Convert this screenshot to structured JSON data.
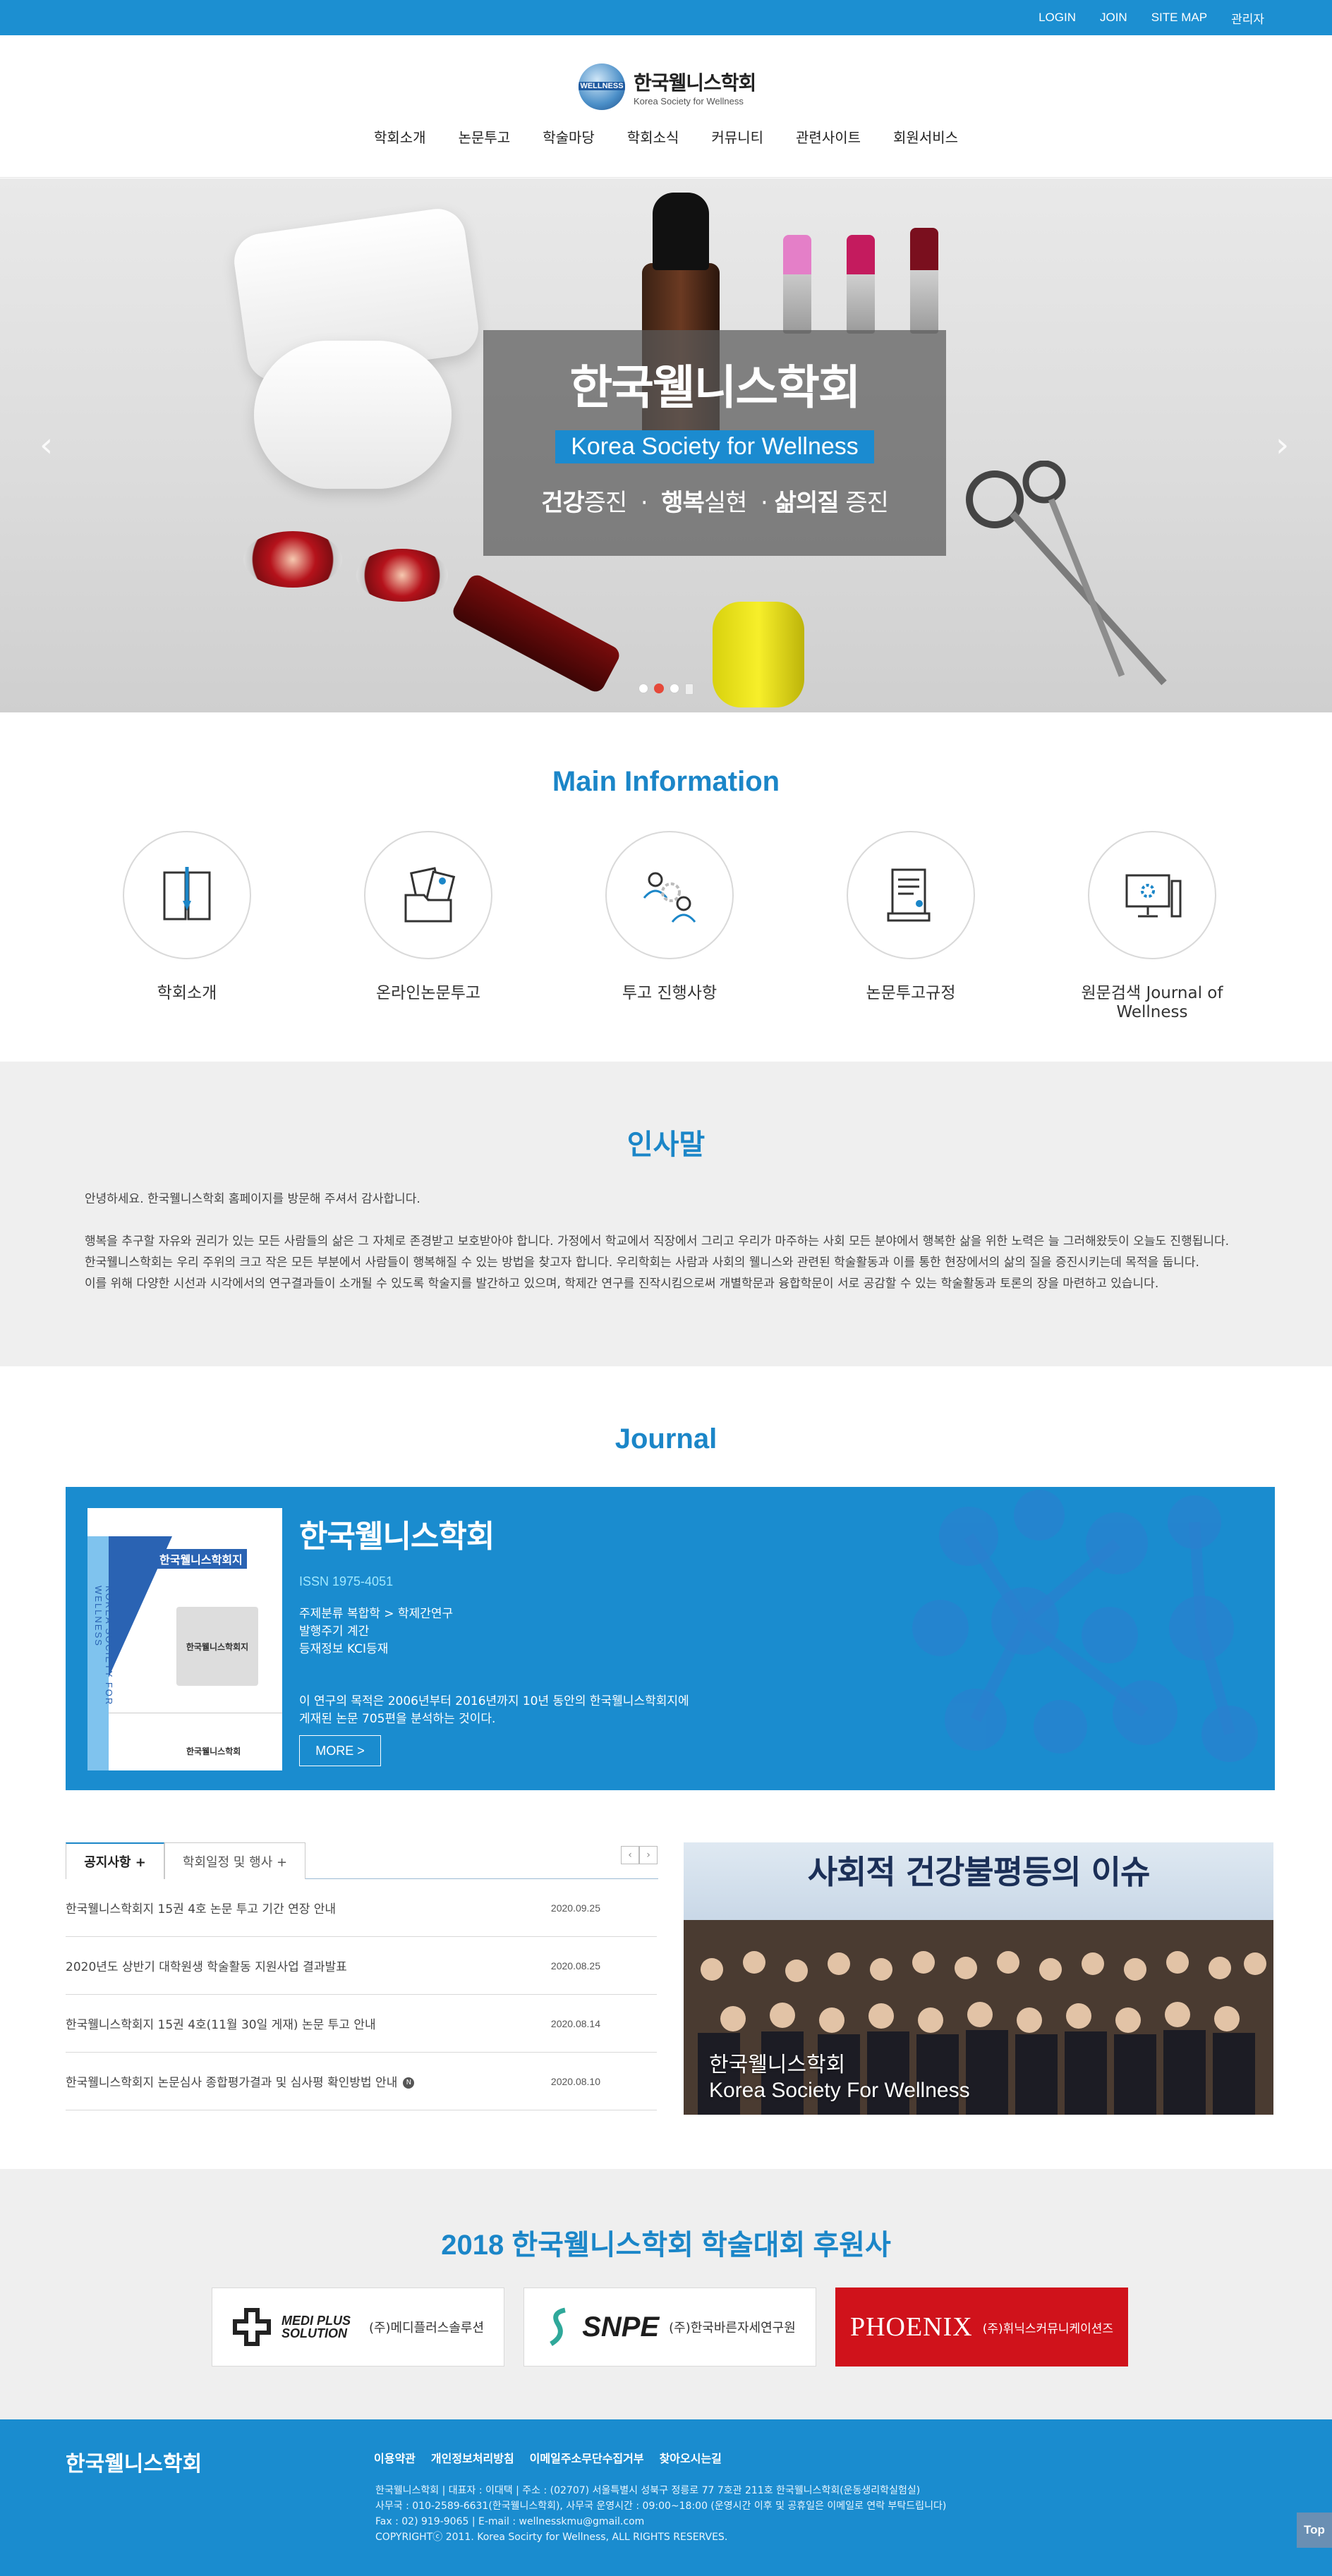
{
  "topbar": {
    "links": [
      "LOGIN",
      "JOIN",
      "SITE MAP",
      "관리자"
    ]
  },
  "logo": {
    "badge": "WELLNESS",
    "name": "한국웰니스학회",
    "sub": "Korea Society for Wellness"
  },
  "gnb": [
    "학회소개",
    "논문투고",
    "학술마당",
    "학회소식",
    "커뮤니티",
    "관련사이트",
    "회원서비스"
  ],
  "hero": {
    "title": "한국웰니스학회",
    "subtitle": "Korea Society for Wellness",
    "slogan_1_b": "건강",
    "slogan_1": "증진",
    "sep": "·",
    "slogan_2_b": "행복",
    "slogan_2": "실현",
    "slogan_3_b": "삶의질",
    "slogan_3": "증진",
    "prev": "‹",
    "next": "›"
  },
  "main_info": {
    "title": "Main Information",
    "items": [
      "학회소개",
      "온라인논문투고",
      "투고 진행사항",
      "논문투고규정",
      "원문검색 Journal of Wellness"
    ]
  },
  "greeting": {
    "title": "인사말",
    "p1": "안녕하세요. 한국웰니스학회 홈페이지를 방문해 주셔서 감사합니다.",
    "p2": "행복을 추구할 자유와 권리가 있는 모든 사람들의 삶은 그 자체로 존경받고 보호받아야 합니다. 가정에서 학교에서 직장에서 그리고 우리가 마주하는 사회 모든 분야에서 행복한 삶을 위한 노력은 늘 그러해왔듯이 오늘도 진행됩니다.",
    "p3": "한국웰니스학회는 우리 주위의 크고 작은 모든 부분에서 사람들이 행복해질 수 있는 방법을 찾고자 합니다. 우리학회는 사람과 사회의 웰니스와 관련된 학술활동과 이를 통한 현장에서의 삶의 질을 증진시키는데 목적을 둡니다.",
    "p4": "이를 위해 다양한 시선과 시각에서의 연구결과들이 소개될 수 있도록 학술지를 발간하고 있으며, 학제간 연구를 진작시킴으로써 개별학문과 융합학문이 서로 공감할 수 있는 학술활동과 토론의 장을 마련하고 있습니다."
  },
  "journal": {
    "title": "Journal",
    "name": "한국웰니스학회",
    "issn": "ISSN 1975-4051",
    "info_1": "주제분류 복합학 > 학제간연구",
    "info_2": "발행주기 계간",
    "info_3": "등재정보 KCI등재",
    "desc_1": "이 연구의 목적은 2006년부터 2016년까지 10년 동안의 한국웰니스학회지에",
    "desc_2": "게재된 논문 705편을 분석하는 것이다.",
    "more": "MORE >",
    "cover_title": "한국웰니스학회지",
    "cover_side": "KOREA SOCIETY FOR WELLNESS",
    "cover_bottom": "한국웰니스학회"
  },
  "notices": {
    "tabs": [
      "공지사항 +",
      "학회일정 및 행사 +"
    ],
    "prev": "‹",
    "next": "›",
    "rows": [
      {
        "title": "한국웰니스학회지 15권 4호 논문 투고 기간 연장 안내",
        "date": "2020.09.25"
      },
      {
        "title": "2020년도 상반기 대학원생 학술활동 지원사업 결과발표",
        "date": "2020.08.25"
      },
      {
        "title": "한국웰니스학회지 15권 4호(11월 30일 게재) 논문 투고 안내",
        "date": "2020.08.14"
      },
      {
        "title": "한국웰니스학회지 논문심사 종합평가결과 및 심사평 확인방법 안내",
        "date": "2020.08.10"
      }
    ]
  },
  "photo": {
    "banner": "사회적 건강불평등의 이슈",
    "caption_1": "한국웰니스학회",
    "caption_2": "Korea Society For Wellness"
  },
  "sponsors": {
    "title": "2018 한국웰니스학회 학술대회 후원사",
    "items": [
      {
        "logo": "MEDI PLUS SOLUTION",
        "name": "(주)메디플러스솔루션"
      },
      {
        "logo": "SNPE",
        "name": "(주)한국바른자세연구원"
      },
      {
        "logo": "PHOENIX",
        "name": "(주)휘닉스커뮤니케이션즈"
      }
    ]
  },
  "footer": {
    "title": "한국웰니스학회",
    "links": [
      "이용약관",
      "개인정보처리방침",
      "이메일주소무단수집거부",
      "찾아오시는길"
    ],
    "line1": "한국웰니스학회 | 대표자 : 이대택 | 주소 : (02707) 서울특별시 성북구 정릉로 77  7호관 211호 한국웰니스학회(운동생리학실험실)",
    "line2": "사무국 : 010-2589-6631(한국웰니스학회),  사무국  운영시간 : 09:00~18:00 (운영시간 이후 및 공휴일은 이메일로 연락 부탁드립니다)",
    "line3": "Fax : 02) 919-9065 | E-mail : wellnesskmu@gmail.com",
    "line4": "COPYRIGHTⓒ 2011. Korea Socirty for Wellness, ALL RIGHTS RESERVES.",
    "top": "Top"
  }
}
